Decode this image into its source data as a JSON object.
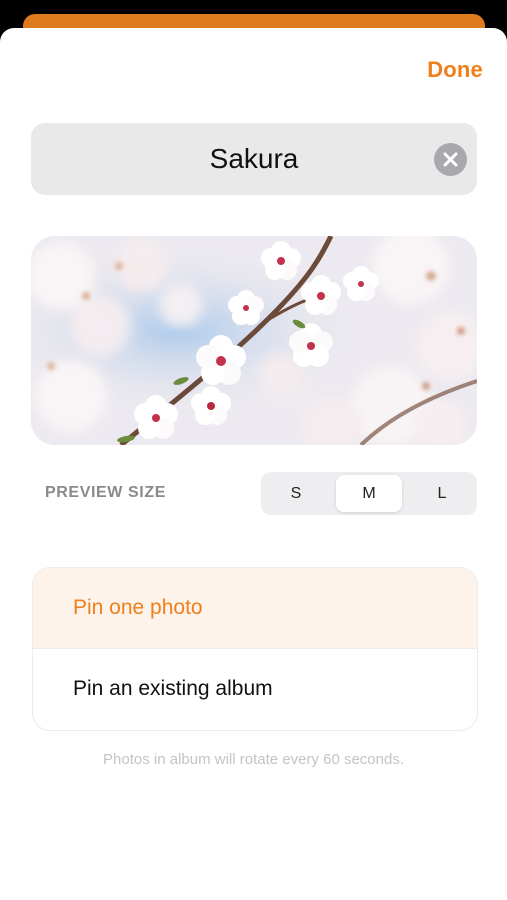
{
  "header": {
    "done_label": "Done"
  },
  "album": {
    "title": "Sakura",
    "clear_icon": "close-circle-icon"
  },
  "photo": {
    "subject": "cherry-blossom-photo"
  },
  "preview_size": {
    "label": "PREVIEW SIZE",
    "options": [
      "S",
      "M",
      "L"
    ],
    "selected": "M"
  },
  "pin_options": {
    "items": [
      {
        "label": "Pin one photo",
        "selected": true
      },
      {
        "label": "Pin an existing album",
        "selected": false
      }
    ]
  },
  "footnote": "Photos in album will rotate every 60 seconds.",
  "colors": {
    "accent": "#ef7f1a",
    "selected_row_bg": "#fdf3ea",
    "field_bg": "#e9e9ea"
  }
}
